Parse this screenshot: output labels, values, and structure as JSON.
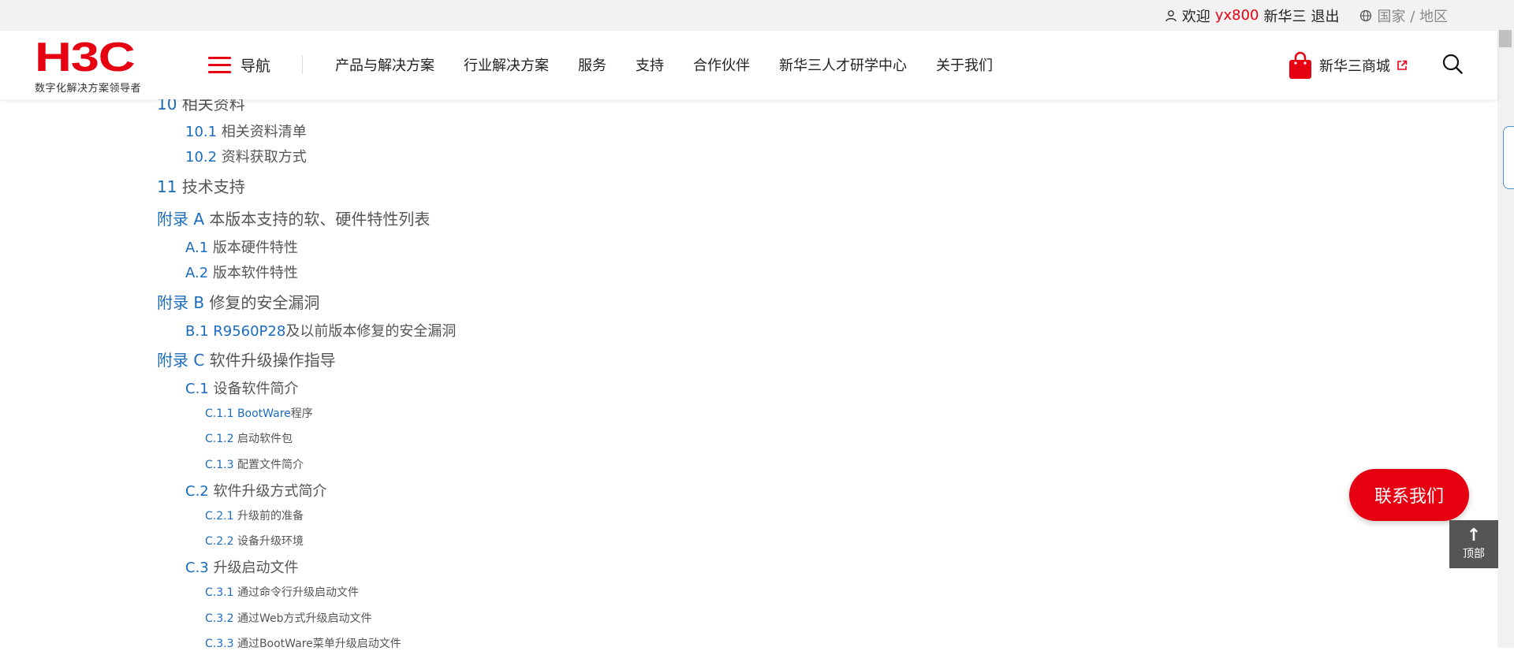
{
  "topbar": {
    "welcome": "欢迎",
    "username": "yx800",
    "org": "新华三",
    "logout": "退出",
    "region": "国家 / 地区"
  },
  "header": {
    "logo_mark": "H3C",
    "logo_sub": "数字化解决方案领导者",
    "nav_toggle": "导航",
    "menu": [
      "产品与解决方案",
      "行业解决方案",
      "服务",
      "支持",
      "合作伙伴",
      "新华三人才研学中心",
      "关于我们"
    ],
    "shop": "新华三商城",
    "accent": "#e60012"
  },
  "toc": [
    {
      "num": "10",
      "text": " 相关资料",
      "level": 1
    },
    {
      "num": "10.1",
      "text": " 相关资料清单",
      "level": 2
    },
    {
      "num": "10.2",
      "text": " 资料获取方式",
      "level": 2
    },
    {
      "num": "11",
      "text": " 技术支持",
      "level": 1
    },
    {
      "num": "附录 A",
      "text": " 本版本支持的软、硬件特性列表",
      "level": 1
    },
    {
      "num": "A.1",
      "text": " 版本硬件特性",
      "level": 2
    },
    {
      "num": "A.2",
      "text": " 版本软件特性",
      "level": 2
    },
    {
      "num": "附录 B",
      "text": " 修复的安全漏洞",
      "level": 1
    },
    {
      "num": "B.1 R9560P28",
      "text": "及以前版本修复的安全漏洞",
      "level": 2
    },
    {
      "num": "附录 C",
      "text": " 软件升级操作指导",
      "level": 1
    },
    {
      "num": "C.1",
      "text": " 设备软件简介",
      "level": 2
    },
    {
      "num": "C.1.1 BootWare",
      "text": "程序",
      "level": 3
    },
    {
      "num": "C.1.2",
      "text": " 启动软件包",
      "level": 3
    },
    {
      "num": "C.1.3",
      "text": " 配置文件简介",
      "level": 3
    },
    {
      "num": "C.2",
      "text": " 软件升级方式简介",
      "level": 2
    },
    {
      "num": "C.2.1",
      "text": " 升级前的准备",
      "level": 3
    },
    {
      "num": "C.2.2",
      "text": " 设备升级环境",
      "level": 3
    },
    {
      "num": "C.3",
      "text": " 升级启动文件",
      "level": 2
    },
    {
      "num": "C.3.1",
      "text": " 通过命令行升级启动文件",
      "level": 3
    },
    {
      "num": "C.3.2",
      "text": " 通过Web方式升级启动文件",
      "level": 3
    },
    {
      "num": "C.3.3",
      "text": " 通过BootWare菜单升级启动文件",
      "level": 3
    }
  ],
  "floating": {
    "contact": "联系我们",
    "top": "顶部"
  }
}
